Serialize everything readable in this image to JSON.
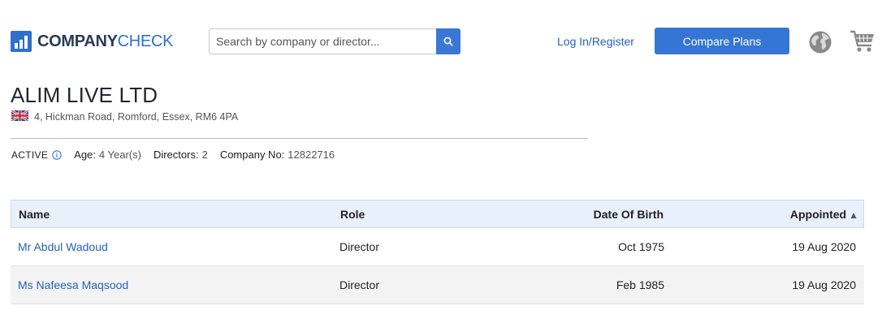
{
  "header": {
    "logo": {
      "bold": "COMPANY",
      "light": "CHECK"
    },
    "search": {
      "placeholder": "Search by company or director...",
      "value": ""
    },
    "login_label": "Log In/Register",
    "compare_label": "Compare Plans"
  },
  "company": {
    "name": "ALIM LIVE LTD",
    "address": "4, Hickman Road, Romford, Essex, RM6 4PA",
    "status": "ACTIVE",
    "age_label": "Age:",
    "age_value": "4 Year(s)",
    "directors_label": "Directors:",
    "directors_value": "2",
    "company_no_label": "Company No:",
    "company_no_value": "12822716"
  },
  "table": {
    "headers": {
      "name": "Name",
      "role": "Role",
      "dob": "Date Of Birth",
      "appointed": "Appointed",
      "sort_indicator": "▲"
    },
    "rows": [
      {
        "name": "Mr Abdul Wadoud",
        "role": "Director",
        "dob": "Oct 1975",
        "appointed": "19 Aug 2020"
      },
      {
        "name": "Ms Nafeesa Maqsood",
        "role": "Director",
        "dob": "Feb 1985",
        "appointed": "19 Aug 2020"
      }
    ]
  },
  "colors": {
    "brand_blue": "#3576d4",
    "link_blue": "#2563b8",
    "header_row_bg": "#e8f0fb"
  },
  "icons": [
    "search-icon",
    "globe-icon",
    "cart-icon",
    "uk-flag-icon",
    "info-icon"
  ]
}
